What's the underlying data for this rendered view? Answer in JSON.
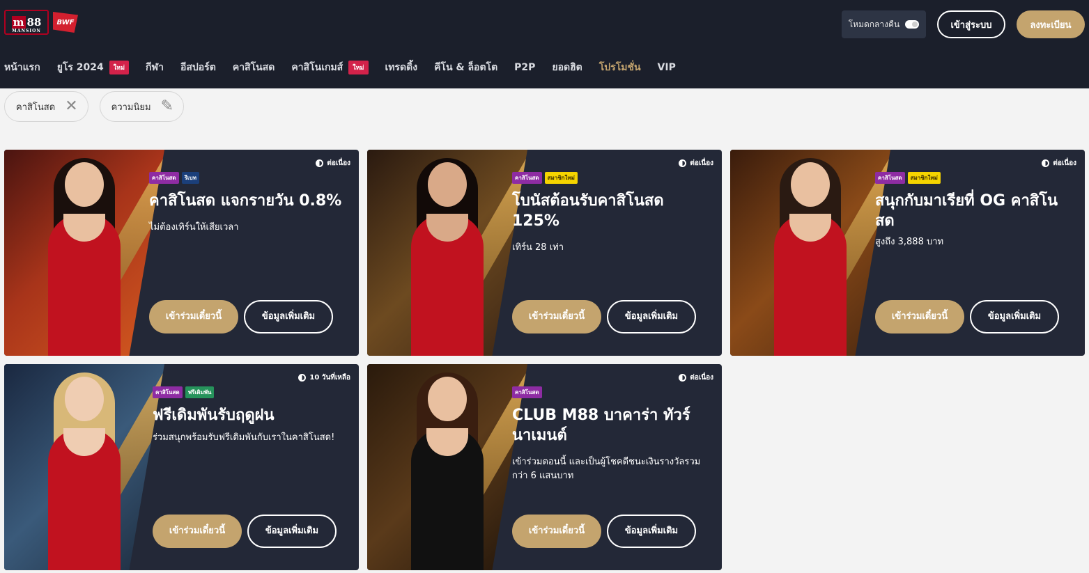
{
  "header": {
    "logo_m88": "88",
    "logo_mansion": "MANSION",
    "logo_bwf": "BWF",
    "dark_mode_label": "โหมดกลางคืน",
    "login_label": "เข้าสู่ระบบ",
    "register_label": "ลงทะเบียน"
  },
  "nav": {
    "items": [
      {
        "label": "หน้าแรก"
      },
      {
        "label": "ยูโร 2024",
        "badge": "ใหม่"
      },
      {
        "label": "กีฬา"
      },
      {
        "label": "อีสปอร์ต"
      },
      {
        "label": "คาสิโนสด"
      },
      {
        "label": "คาสิโนเกมส์",
        "badge": "ใหม่"
      },
      {
        "label": "เทรดดิ้ง"
      },
      {
        "label": "คีโน & ล็อตโต"
      },
      {
        "label": "P2P"
      },
      {
        "label": "ยอดฮิต"
      },
      {
        "label": "โปรโมชั่น",
        "active": true
      },
      {
        "label": "VIP"
      }
    ]
  },
  "filters": [
    {
      "label": "คาสิโนสด",
      "icon": "close-icon"
    },
    {
      "label": "ความนิยม",
      "icon": "pencil-icon"
    }
  ],
  "promos": [
    {
      "status": "ต่อเนื่อง",
      "tags": [
        "คาสิโนสด",
        "รีเบท"
      ],
      "title": "คาสิโนสด แจกรายวัน 0.8%",
      "desc": "ไม่ต้องเทิร์นให้เสียเวลา",
      "join": "เข้าร่วมเดี๋ยวนี้",
      "more": "ข้อมูลเพิ่มเติม"
    },
    {
      "status": "ต่อเนื่อง",
      "tags": [
        "คาสิโนสด",
        "สมาชิกใหม่"
      ],
      "title": "โบนัสต้อนรับคาสิโนสด 125%",
      "desc": "เทิร์น 28 เท่า",
      "join": "เข้าร่วมเดี๋ยวนี้",
      "more": "ข้อมูลเพิ่มเติม"
    },
    {
      "status": "ต่อเนื่อง",
      "tags": [
        "คาสิโนสด",
        "สมาชิกใหม่"
      ],
      "title": "สนุกกับมาเรียที่ OG คาสิโนสด",
      "desc": "สูงถึง 3,888 บาท",
      "join": "เข้าร่วมเดี๋ยวนี้",
      "more": "ข้อมูลเพิ่มเติม"
    },
    {
      "status": "10 วันที่เหลือ",
      "tags": [
        "คาสิโนสด",
        "ฟรีเดิมพัน"
      ],
      "title": "ฟรีเดิมพันรับฤดูฝน",
      "desc": "ร่วมสนุกพร้อมรับฟรีเดิมพันกับเราในคาสิโนสด!",
      "join": "เข้าร่วมเดี๋ยวนี้",
      "more": "ข้อมูลเพิ่มเติม"
    },
    {
      "status": "ต่อเนื่อง",
      "tags": [
        "คาสิโนสด"
      ],
      "title": "CLUB M88 บาคาร่า ทัวร์นาเมนต์",
      "desc": "เข้าร่วมตอนนี้ และเป็นผู้โชคดีชนะเงินรางวัลรวมกว่า 6 แสนบาท",
      "join": "เข้าร่วมเดี๋ยวนี้",
      "more": "ข้อมูลเพิ่มเติม"
    }
  ],
  "colors": {
    "header_bg": "#1b1f2b",
    "accent_gold": "#c4a46e",
    "card_bg": "#232837",
    "badge_red": "#d3224a",
    "tag_purple": "#8e2ca3",
    "tag_blue": "#1b3f7a",
    "tag_yellow": "#f5d400",
    "tag_green": "#26935b"
  }
}
